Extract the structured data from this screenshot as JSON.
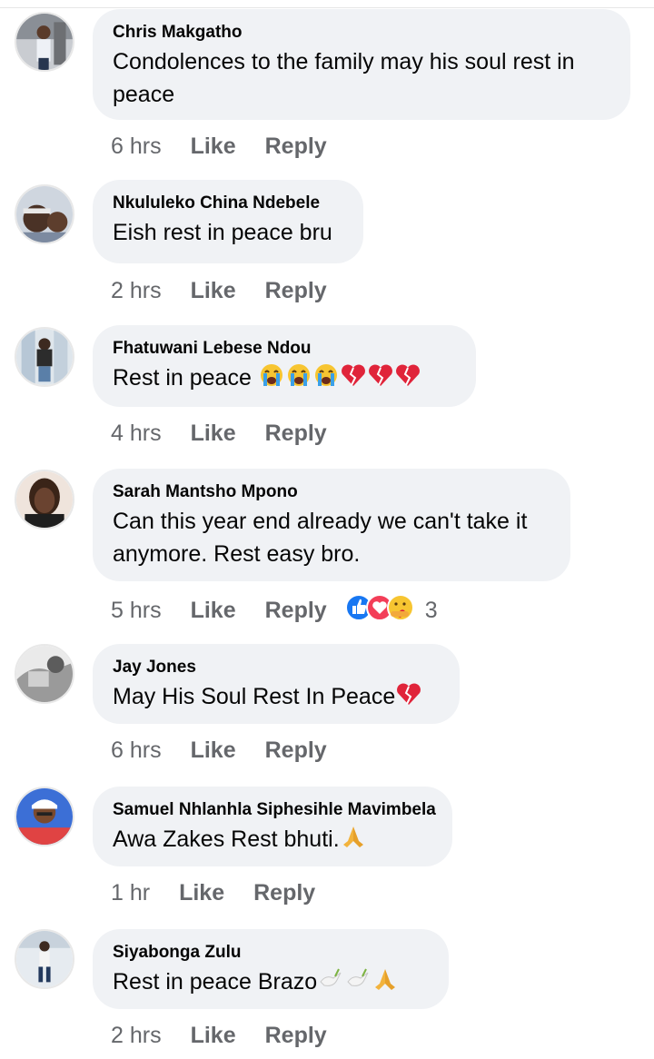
{
  "comments": [
    {
      "author": "Chris Makgatho",
      "text": "Condolences to the family may his soul rest in peace",
      "time": "6 hrs",
      "like": "Like",
      "reply": "Reply"
    },
    {
      "author": "Nkululeko China Ndebele",
      "text": "Eish rest in peace bru",
      "time": "2 hrs",
      "like": "Like",
      "reply": "Reply"
    },
    {
      "author": "Fhatuwani Lebese Ndou",
      "text": "Rest in peace",
      "emojis": [
        "crying-face",
        "crying-face",
        "crying-face",
        "broken-heart",
        "broken-heart",
        "broken-heart"
      ],
      "time": "4 hrs",
      "like": "Like",
      "reply": "Reply"
    },
    {
      "author": "Sarah Mantsho Mpono",
      "text": "Can this year end already we can't take it anymore. Rest easy bro.",
      "time": "5 hrs",
      "like": "Like",
      "reply": "Reply",
      "reactions": {
        "icons": [
          "like",
          "love",
          "care"
        ],
        "count": "3"
      }
    },
    {
      "author": "Jay Jones",
      "text": "May His Soul Rest In Peace",
      "emojis": [
        "broken-heart"
      ],
      "time": "6 hrs",
      "like": "Like",
      "reply": "Reply"
    },
    {
      "author": "Samuel Nhlanhla Siphesihle Mavimbela",
      "text": "Awa Zakes Rest bhuti.",
      "emojis": [
        "folded-hands"
      ],
      "time": "1 hr",
      "like": "Like",
      "reply": "Reply"
    },
    {
      "author": "Siyabonga Zulu",
      "text": "Rest in peace  Brazo",
      "emojis": [
        "dove",
        "dove",
        "folded-hands"
      ],
      "time": "2 hrs",
      "like": "Like",
      "reply": "Reply"
    }
  ],
  "colors": {
    "bubble": "#f0f2f5",
    "meta": "#65676b",
    "text": "#050505"
  }
}
